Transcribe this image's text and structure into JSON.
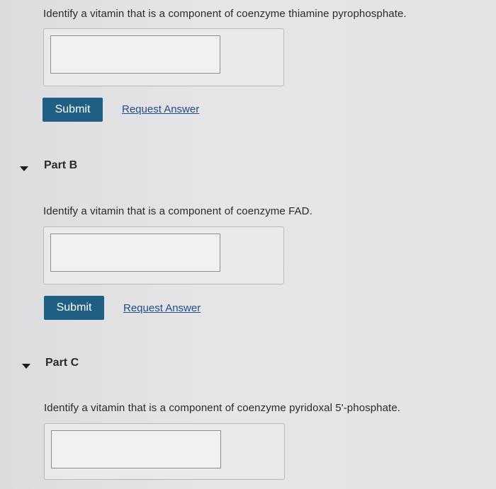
{
  "part_a": {
    "question": "Identify a vitamin that is a component of coenzyme thiamine pyrophosphate.",
    "answer_value": "",
    "submit_label": "Submit",
    "request_answer_label": "Request Answer"
  },
  "part_b": {
    "title": "Part B",
    "toggle_icon": "caret-down-icon",
    "question": "Identify a vitamin that is a component of coenzyme FAD.",
    "answer_value": "",
    "submit_label": "Submit",
    "request_answer_label": "Request Answer"
  },
  "part_c": {
    "title": "Part C",
    "toggle_icon": "caret-down-icon",
    "question": "Identify a vitamin that is a component of coenzyme pyridoxal 5'-phosphate.",
    "answer_value": ""
  },
  "colors": {
    "background": "#e2e2e4",
    "submit_button": "#1f5f84",
    "link": "#234e86"
  }
}
